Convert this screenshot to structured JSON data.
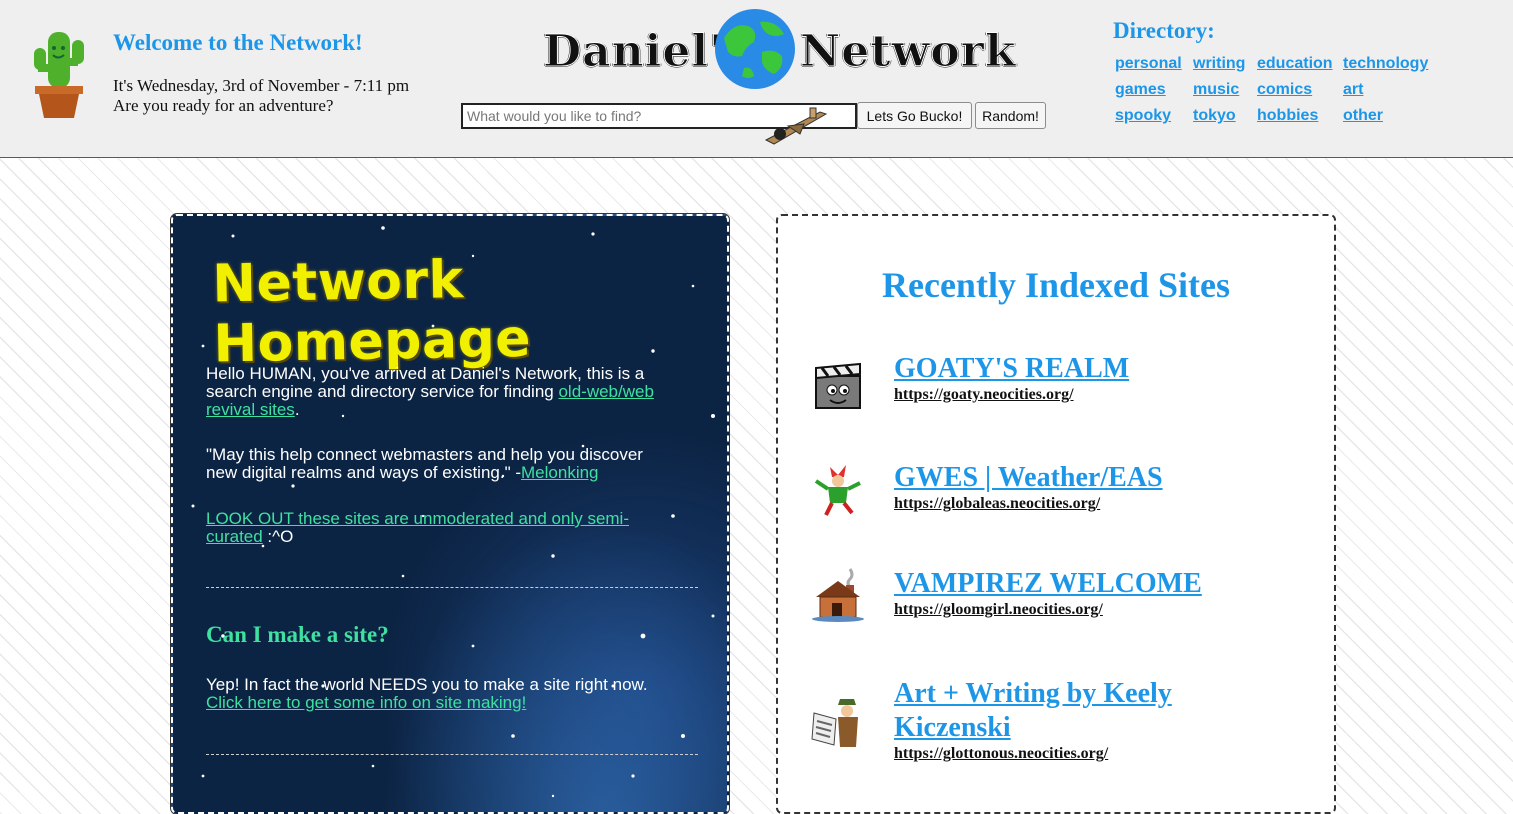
{
  "header": {
    "welcome_title": "Welcome to the Network!",
    "date_line": "It's Wednesday, 3rd of November - 7:11 pm",
    "adventure_line": "Are you ready for an adventure?",
    "logo_left": "Daniel's",
    "logo_right": "Network",
    "search": {
      "placeholder": "What would you like to find?",
      "value": "",
      "go_label": "Lets Go Bucko!",
      "random_label": "Random!"
    },
    "directory": {
      "title": "Directory:",
      "links": [
        "personal",
        "writing",
        "education",
        "technology",
        "games",
        "music",
        "comics",
        "art",
        "spooky",
        "tokyo",
        "hobbies",
        "other"
      ]
    }
  },
  "homepage": {
    "title": "Network Homepage",
    "intro_text": "Hello HUMAN, you've arrived at Daniel's Network, this is a search engine and directory service for finding ",
    "intro_link": "old-web/web revival sites",
    "intro_end": ".",
    "quote_text": "\"May this help connect webmasters and help you discover new digital realms and ways of existing.\" -",
    "quote_link": "Melonking",
    "warning_link": "LOOK OUT these sites are unmoderated and only semi-curated",
    "warning_end": " :^O",
    "subtitle": "Can I make a site?",
    "make_text": "Yep! In fact the world NEEDS you to make a site right now.",
    "make_link": "Click here to get some info on site making!"
  },
  "recent": {
    "title": "Recently Indexed Sites",
    "sites": [
      {
        "name": "GOATY'S REALM",
        "url": "https://goaty.neocities.org/",
        "icon": "clapperboard-icon"
      },
      {
        "name": "GWES | Weather/EAS",
        "url": "https://globaleas.neocities.org/",
        "icon": "jester-icon"
      },
      {
        "name": "VAMPIREZ WELCOME",
        "url": "https://gloomgirl.neocities.org/",
        "icon": "cabin-icon"
      },
      {
        "name": "Art + Writing by Keely Kiczenski",
        "url": "https://glottonous.neocities.org/",
        "icon": "newspaper-reader-icon"
      }
    ]
  },
  "colors": {
    "accent_blue": "#1e96e8",
    "link_green": "#3fe0a0",
    "title_yellow": "#f0f000",
    "header_bg": "#efefef"
  }
}
